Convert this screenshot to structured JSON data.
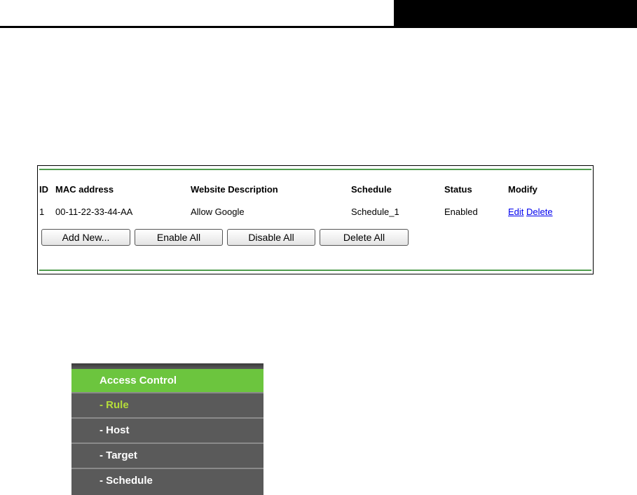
{
  "table": {
    "headers": {
      "id": "ID",
      "mac": "MAC address",
      "description": "Website Description",
      "schedule": "Schedule",
      "status": "Status",
      "modify": "Modify"
    },
    "rows": [
      {
        "id": "1",
        "mac": "00-11-22-33-44-AA",
        "description": "Allow Google",
        "schedule": "Schedule_1",
        "status": "Enabled",
        "edit_label": "Edit",
        "delete_label": "Delete"
      }
    ],
    "buttons": {
      "add_new": "Add New...",
      "enable_all": "Enable All",
      "disable_all": "Disable All",
      "delete_all": "Delete All"
    }
  },
  "menu": {
    "items": [
      {
        "label": "Access Control",
        "type": "header"
      },
      {
        "label": "- Rule",
        "type": "sub",
        "active": true
      },
      {
        "label": "- Host",
        "type": "sub"
      },
      {
        "label": "- Target",
        "type": "sub"
      },
      {
        "label": "- Schedule",
        "type": "sub"
      }
    ]
  },
  "colors": {
    "panel_accent": "#4f9c4d",
    "menu_header": "#6cc53e",
    "menu_background": "#5a5a5a",
    "menu_active_text": "#b5dd3a",
    "link": "#0000ee"
  }
}
